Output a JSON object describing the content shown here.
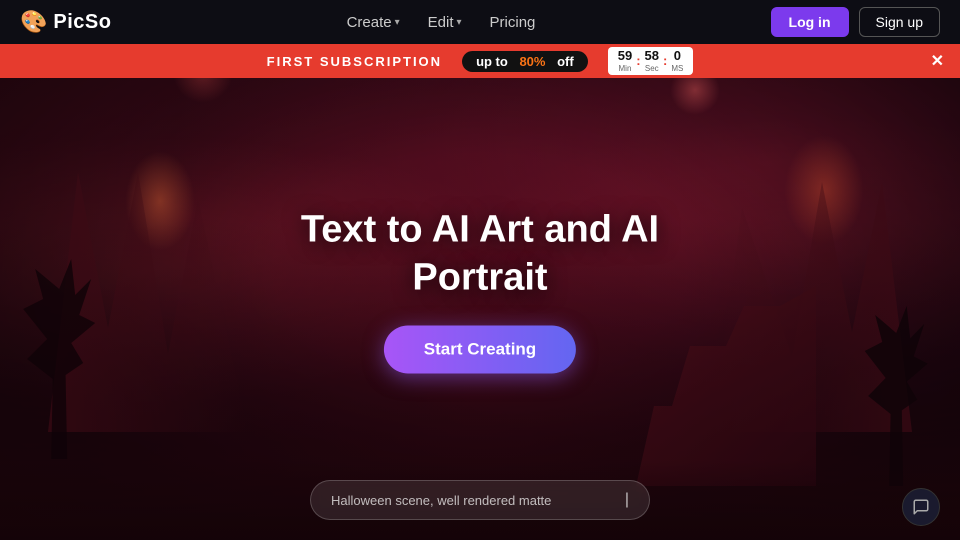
{
  "navbar": {
    "logo_icon": "🎨",
    "logo_text": "PicSo",
    "nav_items": [
      {
        "label": "Create",
        "has_dropdown": true
      },
      {
        "label": "Edit",
        "has_dropdown": true
      },
      {
        "label": "Pricing",
        "has_dropdown": false
      }
    ],
    "login_label": "Log in",
    "signup_label": "Sign up"
  },
  "promo_banner": {
    "text": "FIRST SUBSCRIPTION",
    "badge_prefix": "up to",
    "badge_value": "80%",
    "badge_suffix": "off",
    "timer": {
      "minutes": "59",
      "seconds": "58",
      "milliseconds": "0",
      "labels": [
        "Min",
        "Sec",
        "MS"
      ]
    },
    "close_icon": "✕"
  },
  "hero": {
    "title_line1": "Text to AI Art and AI",
    "title_line2": "Portrait",
    "cta_label": "Start Creating"
  },
  "prompt_bar": {
    "placeholder": "Halloween scene, well rendered matte"
  },
  "chat": {
    "icon": "💬"
  }
}
